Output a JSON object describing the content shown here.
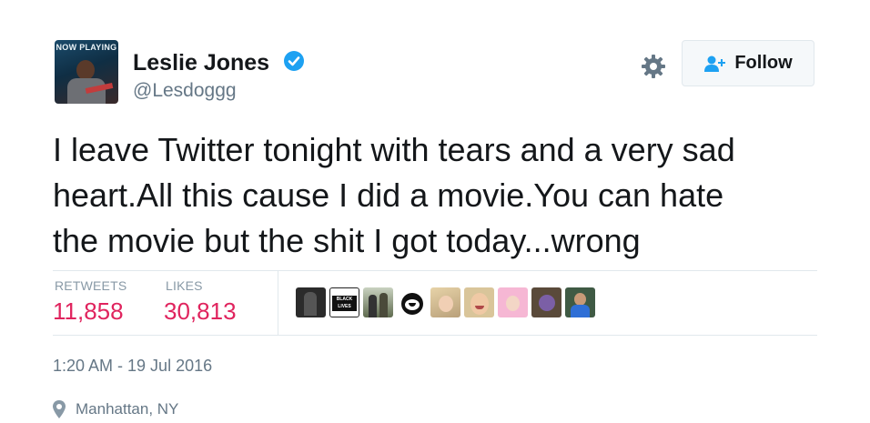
{
  "author": {
    "avatar_caption": "NOW PLAYING",
    "name": "Leslie Jones",
    "handle": "@Lesdoggg",
    "verified": true
  },
  "actions": {
    "follow_label": "Follow"
  },
  "tweet": {
    "text": "I leave Twitter tonight with tears and a very sad\nheart.All this cause I did a movie.You can hate\nthe movie but the shit I got today...wrong"
  },
  "stats": {
    "retweets_label": "RETWEETS",
    "retweets_value": "11,858",
    "likes_label": "LIKES",
    "likes_value": "30,813"
  },
  "likers": [
    {
      "icon": "group-photo-avatar"
    },
    {
      "icon": "black-lives-matter-avatar",
      "text": "BLACK LIVES MATTER"
    },
    {
      "icon": "couple-photo-avatar"
    },
    {
      "icon": "felix-cat-avatar"
    },
    {
      "icon": "blonde-woman-avatar"
    },
    {
      "icon": "smiling-woman-avatar"
    },
    {
      "icon": "pink-hair-avatar"
    },
    {
      "icon": "cartoon-avatar"
    },
    {
      "icon": "man-blue-shirt-avatar"
    }
  ],
  "meta": {
    "timestamp": "1:20 AM - 19 Jul 2016",
    "location": "Manhattan, NY"
  },
  "colors": {
    "accent_blue": "#1da1f2",
    "like_red": "#e0245e",
    "muted": "#657786",
    "text": "#14171a"
  }
}
